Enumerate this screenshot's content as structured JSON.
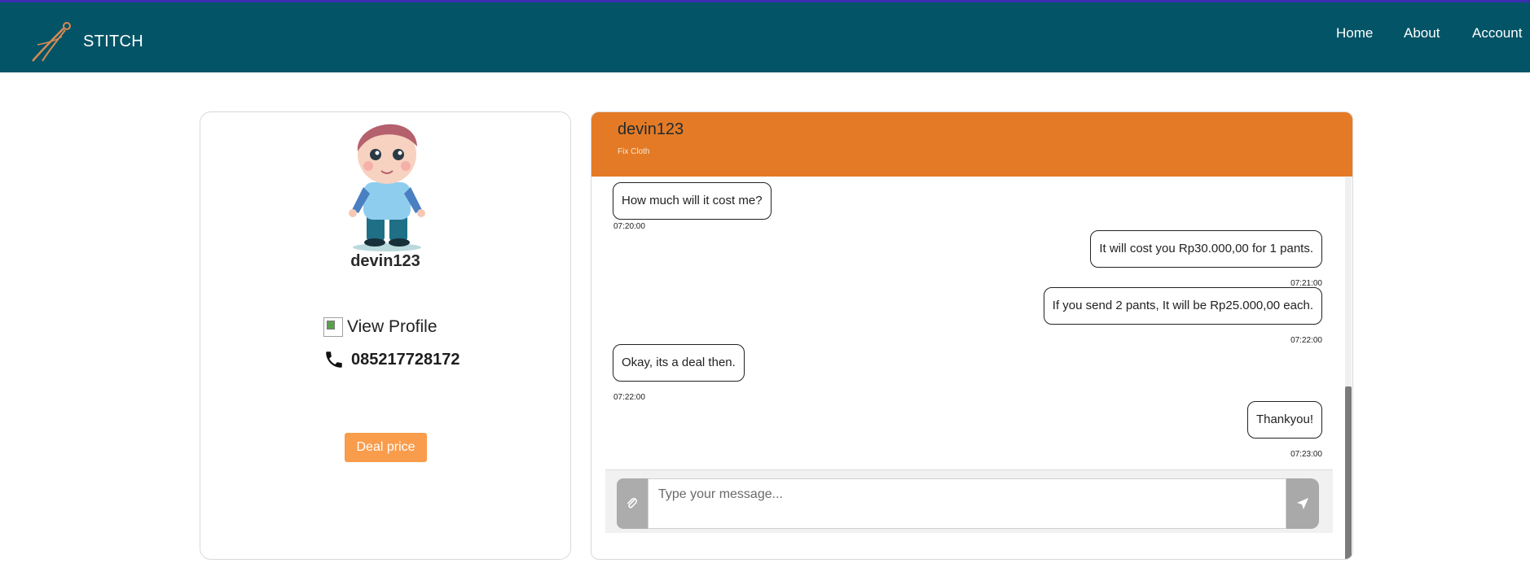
{
  "navbar": {
    "brand": "STITCH",
    "links": {
      "home": "Home",
      "about": "About",
      "account": "Account"
    }
  },
  "profile": {
    "username": "devin123",
    "view_profile": "View Profile",
    "phone": "085217728172",
    "deal_button": "Deal price"
  },
  "chat": {
    "title": "devin123",
    "subtitle": "Fix Cloth",
    "messages": [
      {
        "side": "left",
        "text": "How much will it cost me?",
        "time": "07:20:00"
      },
      {
        "side": "right",
        "text": "It will cost you Rp30.000,00 for 1 pants.",
        "time": "07:21:00"
      },
      {
        "side": "right",
        "text": "If you send 2 pants, It will be Rp25.000,00 each.",
        "time": "07:22:00"
      },
      {
        "side": "left",
        "text": "Okay, its a deal then.",
        "time": "07:22:00"
      },
      {
        "side": "right",
        "text": "Thankyou!",
        "time": "07:23:00"
      }
    ],
    "input_placeholder": "Type your message..."
  },
  "icons": {
    "brand": "needle-thread-icon",
    "phone": "phone-icon",
    "attach": "paperclip-icon",
    "send": "paper-plane-icon"
  },
  "colors": {
    "navbar": "#035467",
    "chat_header": "#e47a25",
    "deal_button": "#f99c4b"
  }
}
